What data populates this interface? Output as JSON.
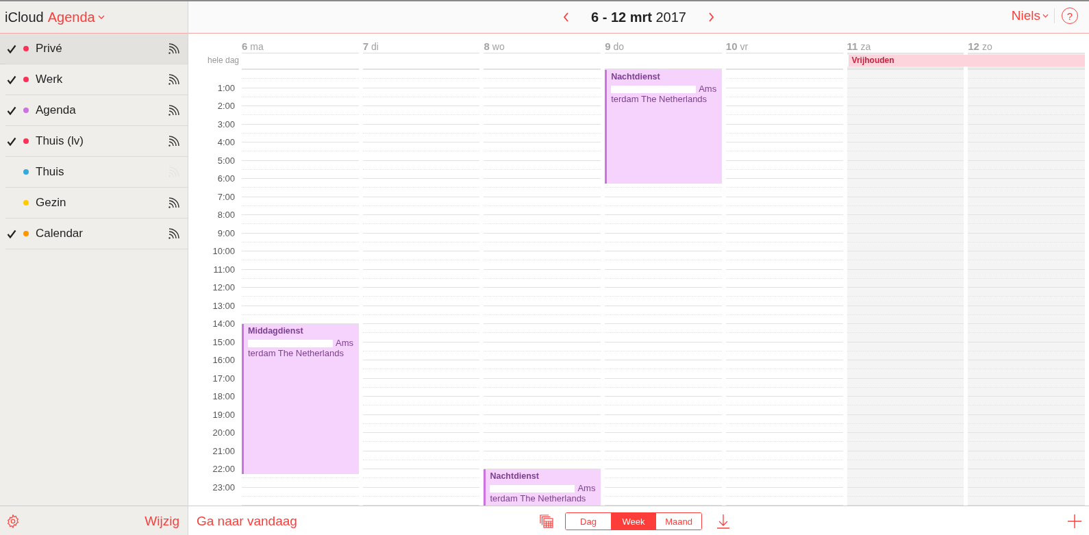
{
  "sidebar": {
    "brand": "iCloud",
    "app_name": "Agenda",
    "calendars": [
      {
        "name": "Privé",
        "checked": true,
        "color": "#fc3158",
        "selected": true,
        "feed_active": true
      },
      {
        "name": "Werk",
        "checked": true,
        "color": "#fc3158",
        "selected": false,
        "feed_active": true
      },
      {
        "name": "Agenda",
        "checked": true,
        "color": "#cc73e1",
        "selected": false,
        "feed_active": true
      },
      {
        "name": "Thuis (lv)",
        "checked": true,
        "color": "#fc3158",
        "selected": false,
        "feed_active": true
      },
      {
        "name": "Thuis",
        "checked": false,
        "color": "#34aadc",
        "selected": false,
        "feed_active": false
      },
      {
        "name": "Gezin",
        "checked": false,
        "color": "#ffcc00",
        "selected": false,
        "feed_active": true
      },
      {
        "name": "Calendar",
        "checked": true,
        "color": "#ff9500",
        "selected": false,
        "feed_active": true
      }
    ],
    "edit_label": "Wijzig"
  },
  "header": {
    "range": "6 - 12 mrt",
    "year": "2017",
    "user": "Niels",
    "help": "?"
  },
  "all_day_label": "hele dag",
  "hours": [
    "1:00",
    "2:00",
    "3:00",
    "4:00",
    "5:00",
    "6:00",
    "7:00",
    "8:00",
    "9:00",
    "10:00",
    "11:00",
    "12:00",
    "13:00",
    "14:00",
    "15:00",
    "16:00",
    "17:00",
    "18:00",
    "19:00",
    "20:00",
    "21:00",
    "22:00",
    "23:00"
  ],
  "days": [
    {
      "number": "6",
      "name": "ma",
      "kind": "weekday",
      "events": [
        {
          "kind": "afternoon",
          "title": "Middagdienst",
          "location": "Amsterdam The Netherlands"
        }
      ]
    },
    {
      "number": "7",
      "name": "di",
      "kind": "weekday"
    },
    {
      "number": "8",
      "name": "wo",
      "kind": "weekday",
      "events": [
        {
          "kind": "night-start",
          "title": "Nachtdienst",
          "location": "Amsterdam The Netherlands"
        }
      ]
    },
    {
      "number": "9",
      "name": "do",
      "kind": "weekday",
      "events": [
        {
          "kind": "night-end",
          "title": "Nachtdienst",
          "location": "Amsterdam The Netherlands"
        }
      ]
    },
    {
      "number": "10",
      "name": "vr",
      "kind": "weekday"
    },
    {
      "number": "11",
      "name": "za",
      "kind": "weekend",
      "all_day_events": [
        {
          "kind": "two-day",
          "title": "Vrijhouden"
        }
      ]
    },
    {
      "number": "12",
      "name": "zo",
      "kind": "weekend"
    }
  ],
  "footer": {
    "today_label": "Ga naar vandaag",
    "views": [
      {
        "label": "Dag",
        "selected": false
      },
      {
        "label": "Week",
        "selected": true
      },
      {
        "label": "Maand",
        "selected": false
      }
    ]
  }
}
